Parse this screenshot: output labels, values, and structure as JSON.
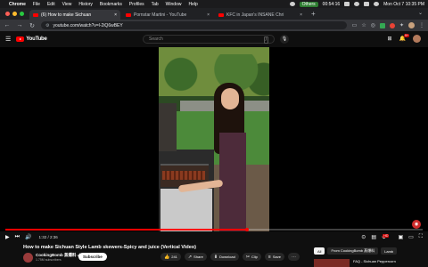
{
  "menubar": {
    "items": [
      "Chrome",
      "File",
      "Edit",
      "View",
      "History",
      "Bookmarks",
      "Profiles",
      "Tab",
      "Window",
      "Help"
    ],
    "right": {
      "meet_label": "Others",
      "timer": "00:54:16",
      "clock": "Mon Oct 7  10:35 PM"
    }
  },
  "tabs": [
    {
      "title": "(6) How to make Sichuan",
      "active": true
    },
    {
      "title": "Pornstar Martini - YouTube",
      "active": false
    },
    {
      "title": "KFC in Japan's INSANE Chri",
      "active": false
    }
  ],
  "toolbar": {
    "url": "youtube.com/watch?v=l-2iQ6wBEY"
  },
  "youtube": {
    "logo": "YouTube",
    "search_placeholder": "Search",
    "search_kbd": "/",
    "notif_count": "9+"
  },
  "player": {
    "time": "1:32 / 2:36",
    "progress": 0.58,
    "hd_label": "HD"
  },
  "video": {
    "title": "How to make Sichuan Style Lamb skewers-Spicy and juice (Vertical Video)",
    "channel_name": "CookingBomb 蒸爆料 ✓",
    "subscribers": "1.75M subscribers",
    "subscribe_label": "Subscribe",
    "actions": [
      {
        "icon": "👍",
        "label": "241"
      },
      {
        "icon": "↗",
        "label": "Share"
      },
      {
        "icon": "⬇",
        "label": "Download"
      },
      {
        "icon": "✂",
        "label": "Clip"
      },
      {
        "icon": "≡",
        "label": "Save"
      },
      {
        "icon": "⋯",
        "label": ""
      }
    ]
  },
  "filter_chips": [
    {
      "label": "All",
      "active": true
    },
    {
      "label": "From CookingBomb 蒸爆料",
      "active": false
    },
    {
      "label": "Lamb",
      "active": false
    }
  ],
  "recommendation": {
    "title": "FAQ - Sichuan Peppercorn"
  },
  "colors": {
    "accent": "#ff0000",
    "background": "#0f0f0f"
  }
}
